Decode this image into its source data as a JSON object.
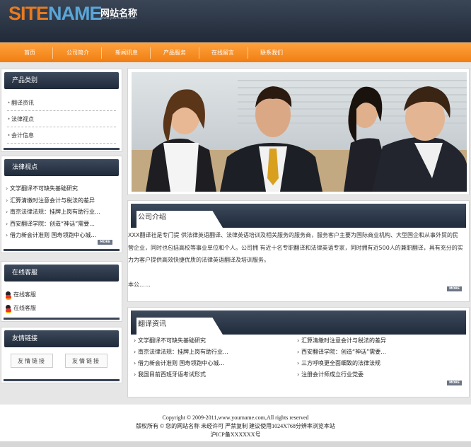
{
  "header": {
    "logo_part1": "SITE",
    "logo_part2": "NAME",
    "logo_cn": "网站名称",
    "logo_url": "www.yourname.com"
  },
  "nav": {
    "items": [
      "首页",
      "公司简介",
      "新闻讯息",
      "产品服务",
      "在线留言",
      "联系我们"
    ]
  },
  "product_categories": {
    "title": "产品类别",
    "items": [
      "翻译资讯",
      "法律视点",
      "会计信息"
    ]
  },
  "law_view": {
    "title": "法律视点",
    "items": [
      "文学翻译不可缺失基础研究",
      "汇算清缴时注意会计与税法的差异",
      "南京法律法规：挂牌上岗有助行业...",
      "西安翻译学院：创造“神话”需要...",
      "借力新会计准则 国寿领跑中心城..."
    ],
    "more": "MORE"
  },
  "online_service": {
    "title": "在线客服",
    "items": [
      "在线客服",
      "在线客服"
    ]
  },
  "friend_links": {
    "title": "友情链接",
    "items": [
      "友情链接",
      "友情链接"
    ]
  },
  "banner": {
    "alt": "business team photo"
  },
  "company_intro": {
    "title": "公司介绍",
    "line1": "XXX翻译社是专门提 供法律英语翻译、法律英语培训及相关服务的服务商，服务客户主要为国际商业机构、大型国企和从事外贸的民",
    "line2": "营企业，同时也包括高校等事业单位和个人。公司拥 有近十名专职翻译和法律英语专家，同时拥有近500人的兼职翻译，具有充分的实",
    "line3": "力为客户提供高效快捷优质的法律英语翻译及培训服务。",
    "line4": "本公……",
    "more": "MORE"
  },
  "translation_news": {
    "title": "翻译资讯",
    "left": [
      "文学翻译不可缺失基础研究",
      "南京法律法规：挂牌上岗有助行业...",
      "借力新会计准则 国寿领跑中心城...",
      "我国目前西班牙语考试形式"
    ],
    "right": [
      "汇算清缴时注意会计与税法的差异",
      "西安翻译学院：创造“神话”需要...",
      "三方呼唤更全面细致的法律法规",
      "注册会计师成立行业党委"
    ],
    "more": "MORE"
  },
  "footer": {
    "line1": "Copyright © 2009-2011,www.yourname.com,All rights reserved",
    "line2": "版权所有 © 您的网站名称 未经许可 严禁复制 建议使用1024X768分辨率浏览本站",
    "line3": "沪ICP备XXXXXX号"
  },
  "colors": {
    "orange": "#f58a1f",
    "navy": "#2a3546",
    "logo_orange": "#e87b1f",
    "logo_blue": "#5aa6d8"
  }
}
